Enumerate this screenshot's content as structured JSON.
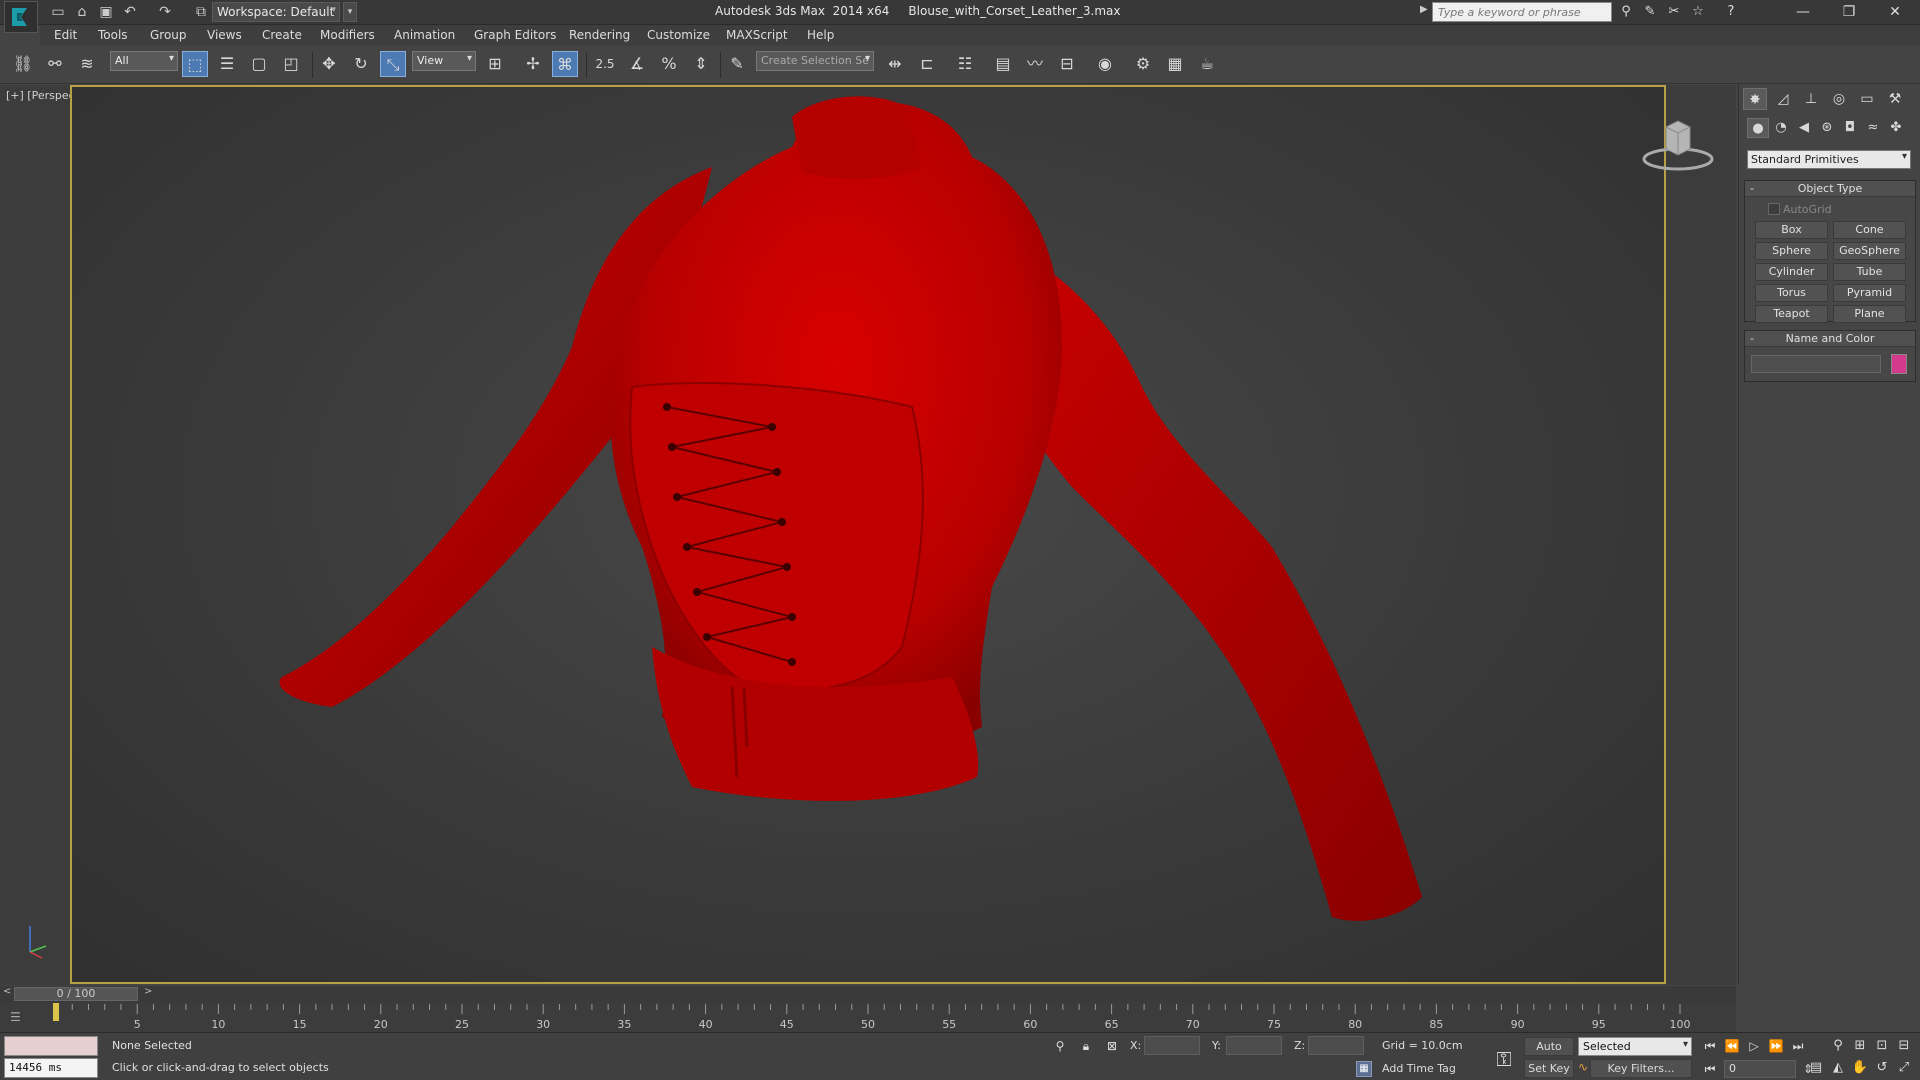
{
  "title_bar": {
    "workspace": "Workspace: Default",
    "app_title": "Autodesk 3ds Max  2014 x64     Blouse_with_Corset_Leather_3.max",
    "search_placeholder": "Type a keyword or phrase",
    "quick_access_icons": [
      "new-file-icon",
      "open-file-icon",
      "save-file-icon",
      "undo-icon",
      "redo-icon",
      "project-folder-icon"
    ],
    "help_icons": [
      "binoculars-icon",
      "infocenter-icon",
      "communication-center-icon",
      "favorites-icon",
      "help-icon"
    ]
  },
  "menu": [
    "Edit",
    "Tools",
    "Group",
    "Views",
    "Create",
    "Modifiers",
    "Animation",
    "Graph Editors",
    "Rendering",
    "Customize",
    "MAXScript",
    "Help"
  ],
  "toolbar": {
    "selection_filter": "All",
    "reference_coord": "View",
    "snap_value": "2.5",
    "named_selection_placeholder": "Create Selection Se",
    "icons": [
      "link-icon",
      "unlink-icon",
      "bind-space-warp-icon",
      "select-object-icon",
      "select-by-name-icon",
      "rect-selection-region-icon",
      "window-crossing-icon",
      "select-move-icon",
      "select-rotate-icon",
      "select-scale-icon",
      "pivot-center-icon",
      "select-manipulate-icon",
      "snaps-toggle-icon",
      "angle-snap-icon",
      "percent-snap-icon",
      "spinner-snap-icon",
      "edit-named-selection-icon",
      "mirror-icon",
      "align-icon",
      "layer-manager-icon",
      "graphite-ribbon-icon",
      "curve-editor-icon",
      "schematic-view-icon",
      "material-editor-icon",
      "render-setup-icon",
      "rendered-frame-window-icon",
      "render-production-icon"
    ]
  },
  "viewport": {
    "label": "[+] [Perspective ] [Shaded ]",
    "garment_color": "#c10000",
    "frame_color": "#b7a144"
  },
  "command_panel": {
    "tabs": [
      "create-tab-icon",
      "modify-tab-icon",
      "hierarchy-tab-icon",
      "motion-tab-icon",
      "display-tab-icon",
      "utilities-tab-icon"
    ],
    "sub_tabs": [
      "geometry-icon",
      "shapes-icon",
      "lights-icon",
      "cameras-icon",
      "helpers-icon",
      "space-warps-icon",
      "systems-icon"
    ],
    "category": "Standard Primitives",
    "object_type": {
      "title": "Object Type",
      "autogrid": "AutoGrid",
      "buttons": [
        "Box",
        "Cone",
        "Sphere",
        "GeoSphere",
        "Cylinder",
        "Tube",
        "Torus",
        "Pyramid",
        "Teapot",
        "Plane"
      ]
    },
    "name_and_color": {
      "title": "Name and Color",
      "name_value": "",
      "swatch_color": "#d43a8c"
    },
    "rollout_minus": "-"
  },
  "time_slider": {
    "prev": "<",
    "position": "0 / 100",
    "next": ">"
  },
  "trackbar": {
    "tick_labels": [
      "5",
      "10",
      "15",
      "20",
      "25",
      "30",
      "35",
      "40",
      "45",
      "50",
      "55",
      "60",
      "65",
      "70",
      "75",
      "80",
      "85",
      "90",
      "95",
      "100"
    ]
  },
  "status": {
    "timing": "14456 ms",
    "selection": "None Selected",
    "prompt": "Click or click-and-drag to select objects",
    "x_label": "X:",
    "y_label": "Y:",
    "z_label": "Z:",
    "x_value": "",
    "y_value": "",
    "z_value": "",
    "grid": "Grid = 10.0cm",
    "add_time_tag": "Add Time Tag",
    "auto_key": "Auto Key",
    "set_key": "Set Key",
    "key_mode": "Selected",
    "key_filters": "Key Filters...",
    "current_frame": "0"
  }
}
